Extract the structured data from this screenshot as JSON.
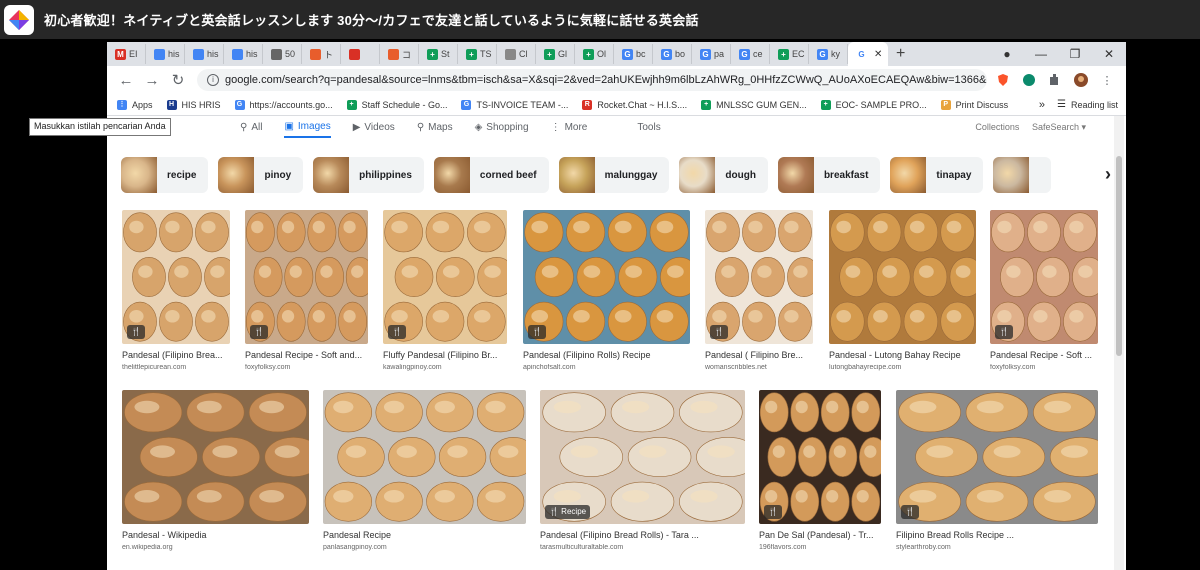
{
  "app": {
    "title": "初心者歓迎！ネイティブと英会話レッスンします 30分〜/カフェで友達と話しているように気軽に話せる英会話"
  },
  "tabs": [
    {
      "label": "EI",
      "icon": "gmail-icon",
      "color": "#d93025",
      "glyph": "M"
    },
    {
      "label": "his",
      "icon": "doc-icon",
      "color": "#4285f4",
      "glyph": ""
    },
    {
      "label": "his",
      "icon": "doc-icon",
      "color": "#4285f4",
      "glyph": ""
    },
    {
      "label": "his",
      "icon": "doc-icon",
      "color": "#4285f4",
      "glyph": ""
    },
    {
      "label": "50",
      "icon": "globe-icon",
      "color": "#666666",
      "glyph": ""
    },
    {
      "label": "ト",
      "icon": "app-icon",
      "color": "#e85d2c",
      "glyph": ""
    },
    {
      "label": "",
      "icon": "record-icon",
      "color": "#d93025",
      "glyph": ""
    },
    {
      "label": "コ",
      "icon": "app-icon",
      "color": "#e85d2c",
      "glyph": ""
    },
    {
      "label": "St",
      "icon": "sheet-icon",
      "color": "#0f9d58",
      "glyph": "+"
    },
    {
      "label": "TS",
      "icon": "sheet-icon",
      "color": "#0f9d58",
      "glyph": "+"
    },
    {
      "label": "Cl",
      "icon": "loading-icon",
      "color": "#888888",
      "glyph": ""
    },
    {
      "label": "Gl",
      "icon": "sheet-icon",
      "color": "#0f9d58",
      "glyph": "+"
    },
    {
      "label": "Ol",
      "icon": "sheet-icon",
      "color": "#0f9d58",
      "glyph": "+"
    },
    {
      "label": "bc",
      "icon": "google-icon",
      "color": "#4285f4",
      "glyph": "G"
    },
    {
      "label": "bo",
      "icon": "google-icon",
      "color": "#4285f4",
      "glyph": "G"
    },
    {
      "label": "pa",
      "icon": "google-icon",
      "color": "#4285f4",
      "glyph": "G"
    },
    {
      "label": "ce",
      "icon": "google-icon",
      "color": "#4285f4",
      "glyph": "G"
    },
    {
      "label": "EC",
      "icon": "sheet-icon",
      "color": "#0f9d58",
      "glyph": "+"
    },
    {
      "label": "ky",
      "icon": "google-icon",
      "color": "#4285f4",
      "glyph": "G"
    }
  ],
  "active_tab": {
    "icon": "google-icon",
    "glyph": "G",
    "close": "✕"
  },
  "new_tab": "+",
  "window_controls": {
    "menu": "●",
    "minimize": "—",
    "restore": "❐",
    "close": "✕"
  },
  "toolbar": {
    "back": "←",
    "forward": "→",
    "reload": "↻",
    "url": "google.com/search?q=pandesal&source=lnms&tbm=isch&sa=X&sqi=2&ved=2ahUKEwjhh9m6lbLzAhWRg_0HHfzZCWwQ_AUoAXoECAEQAw&biw=1366&bih=6...",
    "info": "i",
    "star": "☆"
  },
  "bookmarks": [
    {
      "label": "Apps",
      "icon": "apps-icon",
      "color": "#4285f4",
      "glyph": "⋮"
    },
    {
      "label": "HIS HRIS",
      "icon": "his-icon",
      "color": "#1a3c8f",
      "glyph": "H"
    },
    {
      "label": "https://accounts.go...",
      "icon": "google-icon",
      "color": "#4285f4",
      "glyph": "G"
    },
    {
      "label": "Staff Schedule - Go...",
      "icon": "sheet-icon",
      "color": "#0f9d58",
      "glyph": "+"
    },
    {
      "label": "TS-INVOICE TEAM -...",
      "icon": "google-icon",
      "color": "#4285f4",
      "glyph": "G"
    },
    {
      "label": "Rocket.Chat ~ H.I.S....",
      "icon": "rocket-icon",
      "color": "#d93025",
      "glyph": "R"
    },
    {
      "label": "MNLSSC GUM GEN...",
      "icon": "sheet-icon",
      "color": "#0f9d58",
      "glyph": "+"
    },
    {
      "label": "EOC- SAMPLE PRO...",
      "icon": "sheet-icon",
      "color": "#0f9d58",
      "glyph": "+"
    },
    {
      "label": "Print Discuss",
      "icon": "print-icon",
      "color": "#e8a33c",
      "glyph": "P"
    }
  ],
  "bookmarks_more": "»",
  "reading_list": "Reading list",
  "search_tabs": [
    {
      "label": "All",
      "icon": "search-icon",
      "glyph": "⚲",
      "active": false
    },
    {
      "label": "Images",
      "icon": "image-icon",
      "glyph": "▣",
      "active": true
    },
    {
      "label": "Videos",
      "icon": "video-icon",
      "glyph": "▶",
      "active": false
    },
    {
      "label": "Maps",
      "icon": "map-pin-icon",
      "glyph": "⚲",
      "active": false
    },
    {
      "label": "Shopping",
      "icon": "tag-icon",
      "glyph": "◈",
      "active": false
    },
    {
      "label": "More",
      "icon": "more-icon",
      "glyph": "⋮",
      "active": false
    }
  ],
  "tools_label": "Tools",
  "collections_label": "Collections",
  "safesearch_label": "SafeSearch ▾",
  "tooltip": "Masukkan istilah pencarian Anda",
  "chips": [
    {
      "label": "recipe",
      "color": "#d9b68a"
    },
    {
      "label": "pinoy",
      "color": "#c9955c"
    },
    {
      "label": "philippines",
      "color": "#b88a5a"
    },
    {
      "label": "corned beef",
      "color": "#a87a4d"
    },
    {
      "label": "malunggay",
      "color": "#c6a35a"
    },
    {
      "label": "dough",
      "color": "#e8dcc8"
    },
    {
      "label": "breakfast",
      "color": "#b07a55"
    },
    {
      "label": "tinapay",
      "color": "#e0a35a"
    },
    {
      "label": "",
      "color": "#cbb8a0"
    }
  ],
  "chip_arrow": "›",
  "results_row1": [
    {
      "title": "Pandesal (Filipino Brea...",
      "site": "thelittlepicurean.com",
      "badge": "🍴",
      "bg": "#e9d2b4",
      "bun": "#d7a46b"
    },
    {
      "title": "Pandesal Recipe - Soft and...",
      "site": "foxyfolksy.com",
      "badge": "🍴",
      "bg": "#c9a98a",
      "bun": "#d59a5e"
    },
    {
      "title": "Fluffy Pandesal (Filipino Br...",
      "site": "kawalingpinoy.com",
      "badge": "🍴",
      "bg": "#e6c89a",
      "bun": "#dca769"
    },
    {
      "title": "Pandesal (Filipino Rolls) Recipe",
      "site": "apinchofsalt.com",
      "badge": "🍴",
      "bg": "#5f8fa8",
      "bun": "#d9963f"
    },
    {
      "title": "Pandesal ( Filipino Bre...",
      "site": "womanscribbles.net",
      "badge": "🍴",
      "bg": "#efe5d8",
      "bun": "#d9a56e"
    },
    {
      "title": "Pandesal - Lutong Bahay Recipe",
      "site": "lutongbahayrecipe.com",
      "badge": "",
      "bg": "#b07a3c",
      "bun": "#d49a4e"
    },
    {
      "title": "Pandesal Recipe - Soft ...",
      "site": "foxyfolksy.com",
      "badge": "🍴",
      "bg": "#c08a70",
      "bun": "#e0b08a"
    }
  ],
  "results_row2": [
    {
      "title": "Pandesal - Wikipedia",
      "site": "en.wikipedia.org",
      "badge": "",
      "bg": "#8a6a4a",
      "bun": "#c48b55"
    },
    {
      "title": "Pandesal Recipe",
      "site": "panlasangpinoy.com",
      "badge": "",
      "bg": "#c7c2bb",
      "bun": "#dfae72"
    },
    {
      "title": "Pandesal (Filipino Bread Rolls) - Tara ...",
      "site": "tarasmulticulturaltable.com",
      "badge": "🍴 Recipe",
      "bg": "#d8c8b8",
      "bun": "#e8dccb"
    },
    {
      "title": "Pan De Sal (Pandesal) - Tr...",
      "site": "196flavors.com",
      "badge": "🍴",
      "bg": "#3a2a20",
      "bun": "#d39a5a"
    },
    {
      "title": "Filipino Bread Rolls Recipe ...",
      "site": "stylearthroby.com",
      "badge": "🍴",
      "bg": "#8a8a8a",
      "bun": "#e0b070"
    }
  ]
}
